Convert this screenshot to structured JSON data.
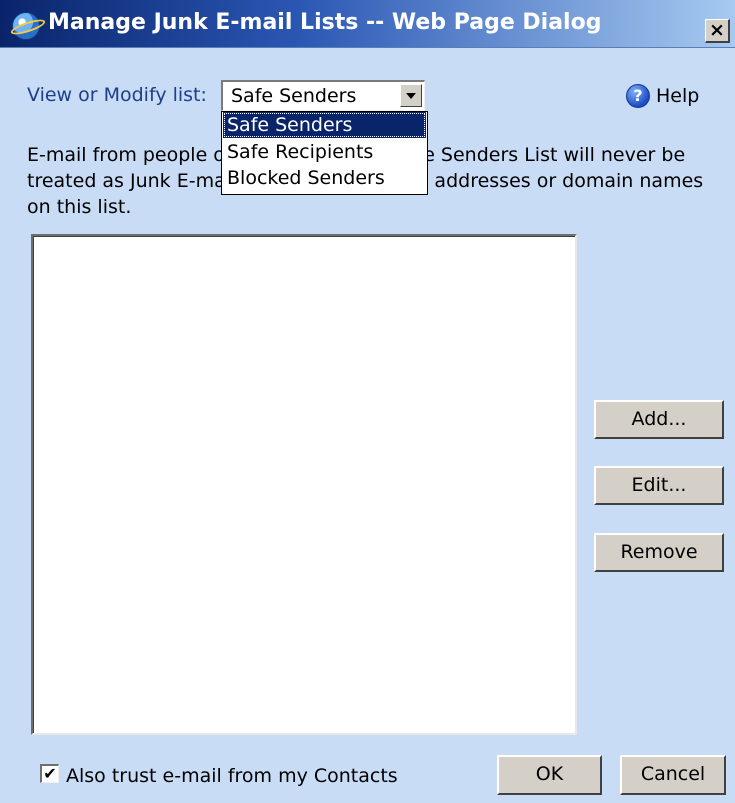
{
  "window": {
    "title": "Manage Junk E-mail Lists -- Web Page Dialog",
    "close_glyph": "×"
  },
  "view_list": {
    "label": "View or Modify list:",
    "selected": "Safe Senders",
    "options": [
      "Safe Senders",
      "Safe Recipients",
      "Blocked Senders"
    ],
    "highlight_color": "#0a246a"
  },
  "help": {
    "icon_glyph": "?",
    "label": "Help"
  },
  "description": "E-mail from people or domains on the Safe Senders List will never be treated as Junk E-mail. You can add e-mail addresses or domain names on this list.",
  "entries": [],
  "buttons": {
    "add": "Add...",
    "edit": "Edit...",
    "remove": "Remove",
    "ok": "OK",
    "cancel": "Cancel"
  },
  "trust_contacts": {
    "checked": true,
    "check_glyph": "✔",
    "label": "Also trust e-mail from my Contacts"
  },
  "colors": {
    "dialog_background": "#c8dcf6",
    "title_bar": "#0a246a",
    "label_text": "#1d3e8a"
  }
}
